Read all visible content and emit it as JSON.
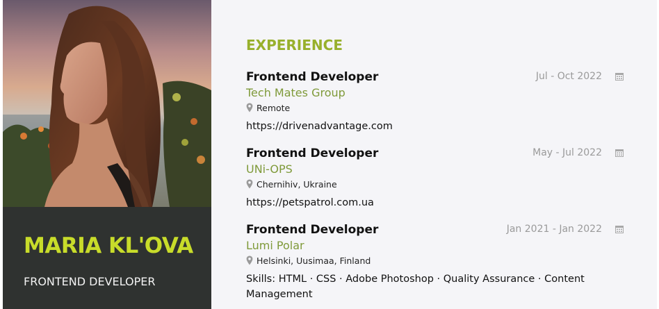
{
  "profile": {
    "name": "MARIA KL'OVA",
    "role": "FRONTEND DEVELOPER"
  },
  "experience": {
    "section_title": "EXPERIENCE",
    "jobs": [
      {
        "title": "Frontend Developer",
        "date": "Jul - Oct 2022",
        "company": "Tech Mates Group",
        "location": "Remote",
        "detail": "https://drivenadvantage.com"
      },
      {
        "title": "Frontend Developer",
        "date": "May - Jul 2022",
        "company": "UNi-OPS",
        "location": "Chernihiv, Ukraine",
        "detail": "https://petspatrol.com.ua"
      },
      {
        "title": "Frontend Developer",
        "date": "Jan 2021 - Jan 2022",
        "company": "Lumi Polar",
        "location": "Helsinki, Uusimaa, Finland",
        "detail": "Skills: HTML · CSS · Adobe Photoshop · Quality Assurance · Content Management"
      }
    ]
  },
  "icons": {
    "calendar": "calendar-icon",
    "location": "map-pin-icon"
  },
  "colors": {
    "accent_name": "#c8dc2a",
    "accent_section": "#98b02c",
    "company": "#7f9a3a",
    "sidebar_bg": "#2f3230",
    "content_bg": "#f5f5f8"
  }
}
